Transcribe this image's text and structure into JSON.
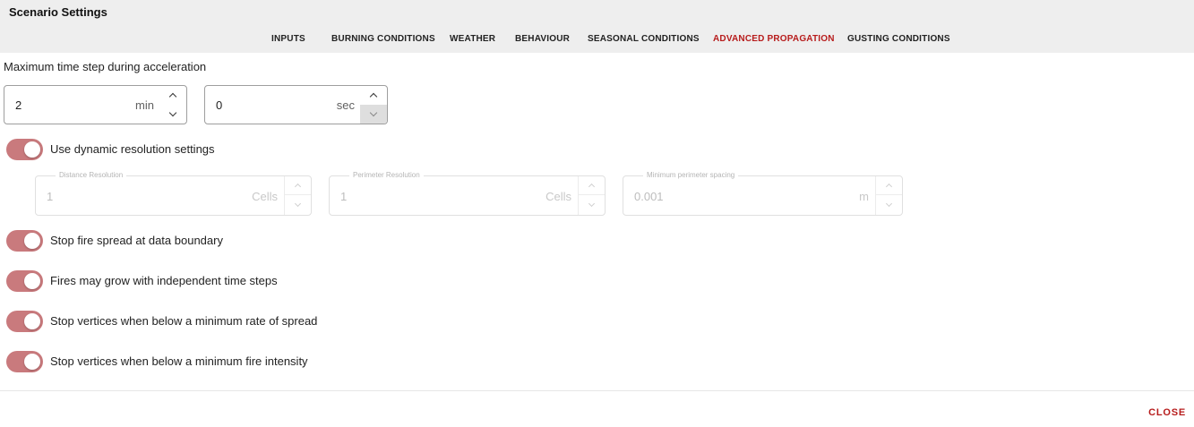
{
  "dialog": {
    "title": "Scenario Settings"
  },
  "tabs": [
    {
      "label": "INPUTS",
      "active": false
    },
    {
      "label": "BURNING CONDITIONS",
      "active": false
    },
    {
      "label": "WEATHER",
      "active": false
    },
    {
      "label": "BEHAVIOUR",
      "active": false
    },
    {
      "label": "SEASONAL CONDITIONS",
      "active": false
    },
    {
      "label": "ADVANCED PROPAGATION",
      "active": true
    },
    {
      "label": "GUSTING CONDITIONS",
      "active": false
    }
  ],
  "accel": {
    "label": "Maximum time step during acceleration",
    "minutes": {
      "value": "2",
      "unit": "min"
    },
    "seconds": {
      "value": "0",
      "unit": "sec"
    }
  },
  "toggles": {
    "dynamic": {
      "label": "Use dynamic resolution settings",
      "on": true
    },
    "boundary": {
      "label": "Stop fire spread at data boundary",
      "on": true
    },
    "independent": {
      "label": "Fires may grow with independent time steps",
      "on": true
    },
    "min_ros": {
      "label": "Stop vertices when below a minimum rate of spread",
      "on": true
    },
    "min_intensity": {
      "label": "Stop vertices when below a minimum fire intensity",
      "on": true
    }
  },
  "resolution": {
    "distance": {
      "legend": "Distance Resolution",
      "value": "1",
      "unit": "Cells"
    },
    "perimeter": {
      "legend": "Perimeter Resolution",
      "value": "1",
      "unit": "Cells"
    },
    "spacing": {
      "legend": "Minimum perimeter spacing",
      "value": "0.001",
      "unit": "m"
    }
  },
  "footer": {
    "close_label": "CLOSE"
  },
  "colors": {
    "accent": "#b71c1c",
    "toggle_track": "#c97a7d",
    "header_bg": "#eeeeee"
  },
  "icons": {
    "stepper_up": "chevron-up-icon",
    "stepper_down": "chevron-down-icon"
  }
}
